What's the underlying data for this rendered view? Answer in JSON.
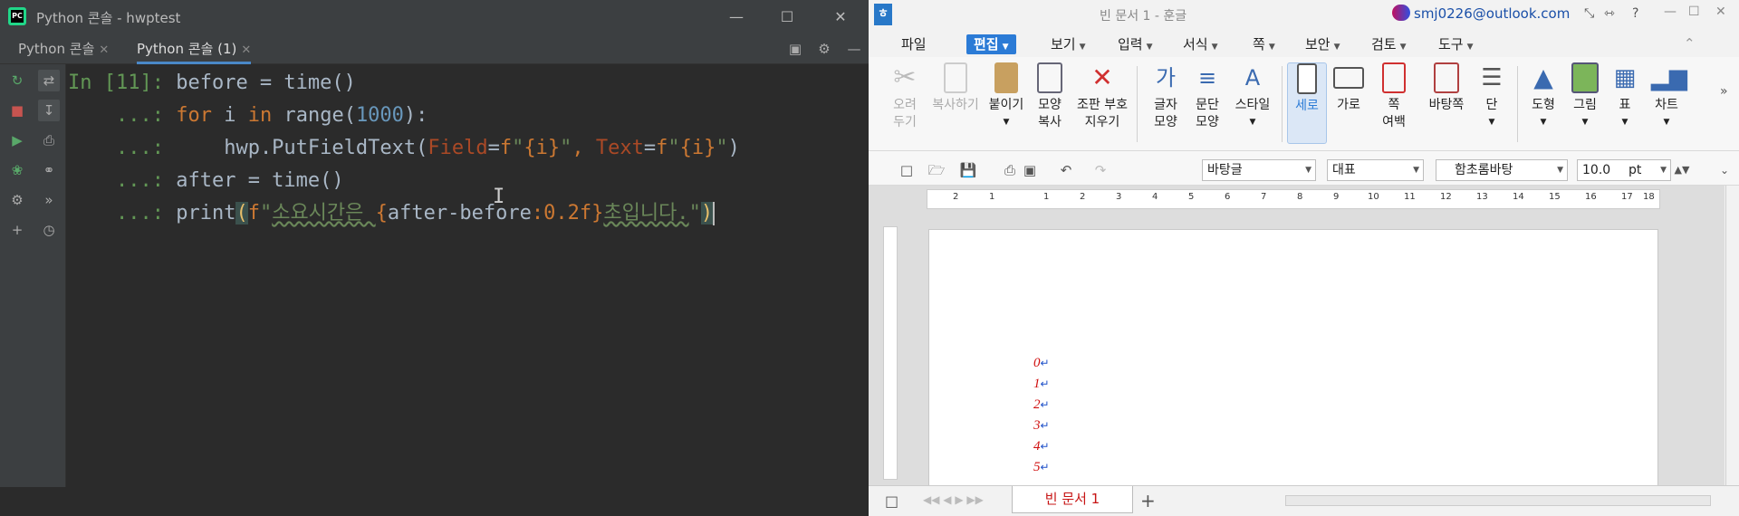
{
  "pycharm": {
    "title": "Python 콘솔 - hwptest",
    "tabs": [
      {
        "label": "Python 콘솔"
      },
      {
        "label": "Python 콘솔 (1)"
      }
    ],
    "code": {
      "prompt_in": "In [11]:",
      "prompt_cont": "...:",
      "line1": "before = time()",
      "line2_for": "for",
      "line2_i": " i ",
      "line2_in": "in",
      "line2_range": " range(",
      "line2_num": "1000",
      "line2_end": "):",
      "line3_call": "hwp.PutFieldText(",
      "line3_p1": "Field",
      "line3_eq1": "=",
      "line3_f1": "f",
      "line3_s1a": "\"",
      "line3_br1": "{i}",
      "line3_s1b": "\"",
      "line3_comma": ", ",
      "line3_p2": "Text",
      "line3_eq2": "=",
      "line3_f2": "f",
      "line3_s2a": "\"",
      "line3_br2": "{i}",
      "line3_s2b": "\"",
      "line3_close": ")",
      "line4": "after = time()",
      "line5_print": "print",
      "line5_open": "(",
      "line5_f": "f",
      "line5_q": "\"",
      "line5_kr1": "소요시간은 ",
      "line5_lb": "{",
      "line5_expr": "after-before",
      "line5_fmt": ":0.2f",
      "line5_rb": "}",
      "line5_kr2": "초입니다.",
      "line5_q2": "\"",
      "line5_close": ")"
    }
  },
  "hwp": {
    "title": "빈 문서 1 - 훈글",
    "account": "smj0226@outlook.com",
    "menu": [
      "파일",
      "편집",
      "보기",
      "입력",
      "서식",
      "쪽",
      "보안",
      "검토",
      "도구"
    ],
    "ribbon": {
      "cut": [
        "오려",
        "두기"
      ],
      "copy": "복사하기",
      "paste": "붙이기",
      "format_copy": [
        "모양",
        "복사"
      ],
      "clear": [
        "조판 부호",
        "지우기"
      ],
      "char": [
        "글자",
        "모양"
      ],
      "para": [
        "문단",
        "모양"
      ],
      "style": "스타일",
      "vertical": "세로",
      "horizontal": "가로",
      "margin": [
        "쪽",
        "여백"
      ],
      "page_border": "바탕쪽",
      "columns": "단",
      "shape": "도형",
      "image": "그림",
      "table": "표",
      "chart": "차트"
    },
    "toolbar": {
      "style_select": "바탕글",
      "lang_select": "대표",
      "font_select": "함초롬바탕",
      "size_value": "10.0",
      "size_unit": "pt"
    },
    "ruler_ticks": [
      "2",
      "1",
      "1",
      "2",
      "3",
      "4",
      "5",
      "6",
      "7",
      "8",
      "9",
      "10",
      "11",
      "12",
      "13",
      "14",
      "15",
      "16",
      "17",
      "18"
    ],
    "paragraphs": [
      "0",
      "1",
      "2",
      "3",
      "4",
      "5"
    ],
    "doc_tab": "빈 문서 1"
  }
}
